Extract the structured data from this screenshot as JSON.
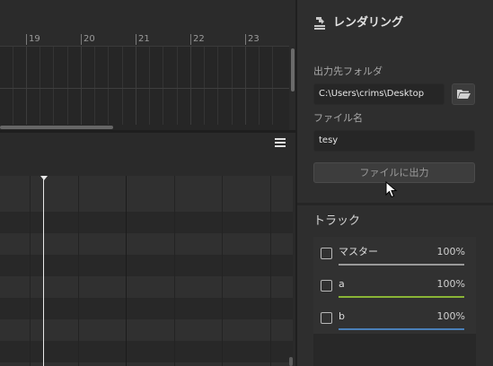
{
  "timeline": {
    "ruler_labels": [
      "19",
      "20",
      "21",
      "22",
      "23"
    ]
  },
  "render_panel": {
    "title": "レンダリング",
    "output_folder_label": "出力先フォルダ",
    "output_folder_value": "C:\\Users\\crims\\Desktop",
    "file_name_label": "ファイル名",
    "file_name_value": "tesy",
    "export_button_label": "ファイルに出力",
    "tracks_heading": "トラック",
    "tracks": [
      {
        "name": "マスター",
        "volume": "100%",
        "color": "#9a9a9a"
      },
      {
        "name": "a",
        "volume": "100%",
        "color": "#8ab536"
      },
      {
        "name": "b",
        "volume": "100%",
        "color": "#4a7fb8"
      }
    ]
  }
}
